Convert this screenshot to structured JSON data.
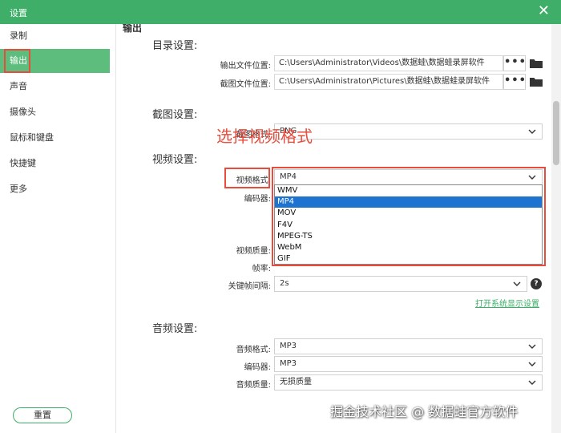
{
  "window": {
    "title": "设置",
    "close_glyph": "✕"
  },
  "sidebar": {
    "items": [
      {
        "label": "录制"
      },
      {
        "label": "输出"
      },
      {
        "label": "声音"
      },
      {
        "label": "摄像头"
      },
      {
        "label": "鼠标和键盘"
      },
      {
        "label": "快捷键"
      },
      {
        "label": "更多"
      }
    ],
    "reset_label": "重置"
  },
  "main": {
    "section_partial": "输出",
    "directory": {
      "title": "目录设置:",
      "output_label": "输出文件位置:",
      "output_path": "C:\\Users\\Administrator\\Videos\\数据蛙\\数据蛙录屏软件",
      "screenshot_label": "截图文件位置:",
      "screenshot_path": "C:\\Users\\Administrator\\Pictures\\数据蛙\\数据蛙录屏软件",
      "browse_glyph": "•••"
    },
    "screenshot": {
      "title": "截图设置:",
      "format_label": "截图格式:",
      "format_value": "PNG"
    },
    "video": {
      "title": "视频设置:",
      "format_label": "视频格式:",
      "format_value": "MP4",
      "format_options": [
        "WMV",
        "MP4",
        "MOV",
        "F4V",
        "MPEG-TS",
        "WebM",
        "GIF"
      ],
      "encoder_label": "编码器:",
      "quality_label": "视频质量:",
      "framerate_label": "帧率:",
      "keyframe_label": "关键帧间隔:",
      "keyframe_value": "2s",
      "display_link": "打开系统显示设置"
    },
    "audio": {
      "title": "音频设置:",
      "format_label": "音频格式:",
      "format_value": "MP3",
      "encoder_label": "编码器:",
      "encoder_value": "MP3",
      "quality_label": "音频质量:",
      "quality_value": "无损质量"
    }
  },
  "annotation": "选择视频格式",
  "watermark": "掘金技术社区 @ 数据蛙官方软件",
  "colors": {
    "accent": "#3fae68",
    "active_nav": "#5cbd7c",
    "highlight": "#e74c3c",
    "dropdown_selected": "#1e73d0"
  }
}
